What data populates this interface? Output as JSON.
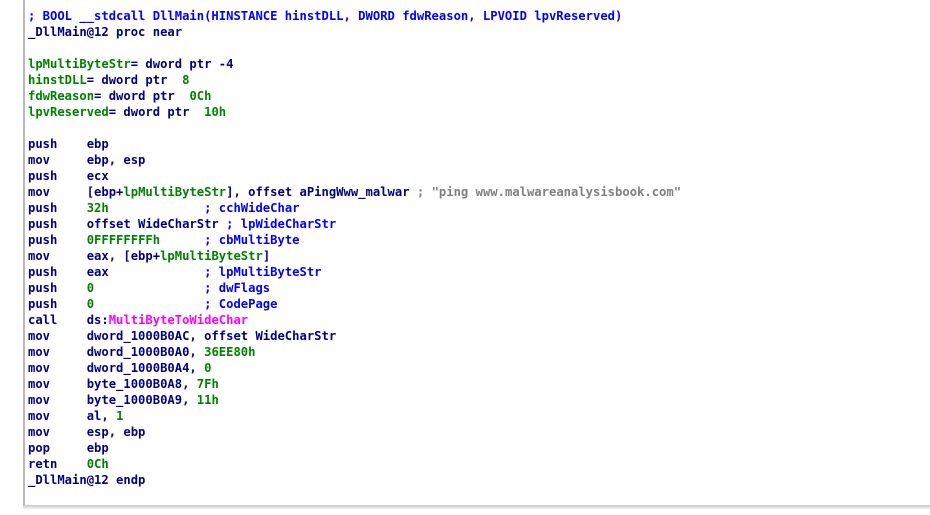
{
  "colors": {
    "instruction": "#000080",
    "comment": "#0000ff",
    "number": "#008000",
    "variable": "#008000",
    "import": "#ff00ff",
    "string_comment": "#808080",
    "background": "#ffffff"
  },
  "lines": [
    [
      {
        "t": "; BOOL __stdcall DllMain(HINSTANCE hinstDLL, DWORD fdwReason, LPVOID lpvReserved)",
        "c": "comment"
      }
    ],
    [
      {
        "t": "_DllMain@12 proc near",
        "c": "text"
      }
    ],
    [
      {
        "t": "",
        "c": "text"
      }
    ],
    [
      {
        "t": "lpMultiByteStr",
        "c": "var"
      },
      {
        "t": "= dword ptr -4",
        "c": "text"
      }
    ],
    [
      {
        "t": "hinstDLL",
        "c": "var"
      },
      {
        "t": "= dword ptr  ",
        "c": "text"
      },
      {
        "t": "8",
        "c": "num"
      }
    ],
    [
      {
        "t": "fdwReason",
        "c": "var"
      },
      {
        "t": "= dword ptr  ",
        "c": "text"
      },
      {
        "t": "0Ch",
        "c": "num"
      }
    ],
    [
      {
        "t": "lpvReserved",
        "c": "var"
      },
      {
        "t": "= dword ptr  ",
        "c": "text"
      },
      {
        "t": "10h",
        "c": "num"
      }
    ],
    [
      {
        "t": "",
        "c": "text"
      }
    ],
    [
      {
        "t": "push    ebp",
        "c": "text"
      }
    ],
    [
      {
        "t": "mov     ebp, esp",
        "c": "text"
      }
    ],
    [
      {
        "t": "push    ecx",
        "c": "text"
      }
    ],
    [
      {
        "t": "mov     [ebp+",
        "c": "text"
      },
      {
        "t": "lpMultiByteStr",
        "c": "var"
      },
      {
        "t": "], offset aPingWww_malwar ",
        "c": "text"
      },
      {
        "t": "; \"ping www.malwareanalysisbook.com\"",
        "c": "str"
      }
    ],
    [
      {
        "t": "push    ",
        "c": "text"
      },
      {
        "t": "32h",
        "c": "num"
      },
      {
        "t": "             ",
        "c": "text"
      },
      {
        "t": "; cchWideChar",
        "c": "comment"
      }
    ],
    [
      {
        "t": "push    offset WideCharStr ",
        "c": "text"
      },
      {
        "t": "; lpWideCharStr",
        "c": "comment"
      }
    ],
    [
      {
        "t": "push    ",
        "c": "text"
      },
      {
        "t": "0FFFFFFFFh",
        "c": "num"
      },
      {
        "t": "      ",
        "c": "text"
      },
      {
        "t": "; cbMultiByte",
        "c": "comment"
      }
    ],
    [
      {
        "t": "mov     eax, [ebp+",
        "c": "text"
      },
      {
        "t": "lpMultiByteStr",
        "c": "var"
      },
      {
        "t": "]",
        "c": "text"
      }
    ],
    [
      {
        "t": "push    eax             ",
        "c": "text"
      },
      {
        "t": "; lpMultiByteStr",
        "c": "comment"
      }
    ],
    [
      {
        "t": "push    ",
        "c": "text"
      },
      {
        "t": "0",
        "c": "num"
      },
      {
        "t": "               ",
        "c": "text"
      },
      {
        "t": "; dwFlags",
        "c": "comment"
      }
    ],
    [
      {
        "t": "push    ",
        "c": "text"
      },
      {
        "t": "0",
        "c": "num"
      },
      {
        "t": "               ",
        "c": "text"
      },
      {
        "t": "; CodePage",
        "c": "comment"
      }
    ],
    [
      {
        "t": "call    ds:",
        "c": "text"
      },
      {
        "t": "MultiByteToWideChar",
        "c": "import"
      }
    ],
    [
      {
        "t": "mov     dword_1000B0AC, offset WideCharStr",
        "c": "text"
      }
    ],
    [
      {
        "t": "mov     dword_1000B0A0, ",
        "c": "text"
      },
      {
        "t": "36EE80h",
        "c": "num"
      }
    ],
    [
      {
        "t": "mov     dword_1000B0A4, ",
        "c": "text"
      },
      {
        "t": "0",
        "c": "num"
      }
    ],
    [
      {
        "t": "mov     byte_1000B0A8, ",
        "c": "text"
      },
      {
        "t": "7Fh",
        "c": "num"
      }
    ],
    [
      {
        "t": "mov     byte_1000B0A9, ",
        "c": "text"
      },
      {
        "t": "11h",
        "c": "num"
      }
    ],
    [
      {
        "t": "mov     al, ",
        "c": "text"
      },
      {
        "t": "1",
        "c": "num"
      }
    ],
    [
      {
        "t": "mov     esp, ebp",
        "c": "text"
      }
    ],
    [
      {
        "t": "pop     ebp",
        "c": "text"
      }
    ],
    [
      {
        "t": "retn    ",
        "c": "text"
      },
      {
        "t": "0Ch",
        "c": "num"
      }
    ],
    [
      {
        "t": "_DllMain@12 endp",
        "c": "text"
      }
    ]
  ]
}
